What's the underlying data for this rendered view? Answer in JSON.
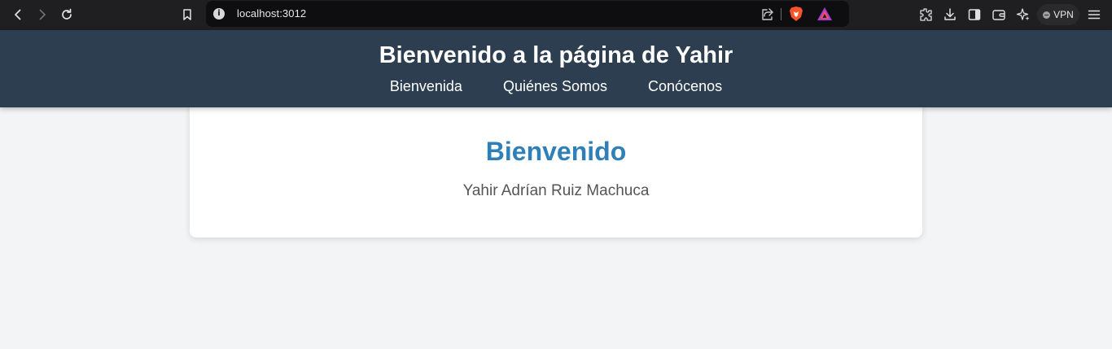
{
  "browser": {
    "url": "localhost:3012",
    "vpn_label": "VPN",
    "info_glyph": "i",
    "icons": [
      "back-icon",
      "forward-icon",
      "reload-icon",
      "bookmark-icon",
      "site-info-icon",
      "share-icon",
      "brave-shields-icon",
      "brave-rewards-icon",
      "extensions-icon",
      "downloads-icon",
      "sidebar-icon",
      "wallet-icon",
      "leo-ai-icon",
      "menu-icon"
    ]
  },
  "header": {
    "title": "Bienvenido a la página de Yahir",
    "nav": [
      "Bienvenida",
      "Quiénes Somos",
      "Conócenos"
    ]
  },
  "main": {
    "heading": "Bienvenido",
    "subtitle": "Yahir Adrían Ruiz Machuca"
  },
  "colors": {
    "header_bg": "#2d3e50",
    "heading": "#2f80b8",
    "page_bg": "#f3f4f6"
  }
}
